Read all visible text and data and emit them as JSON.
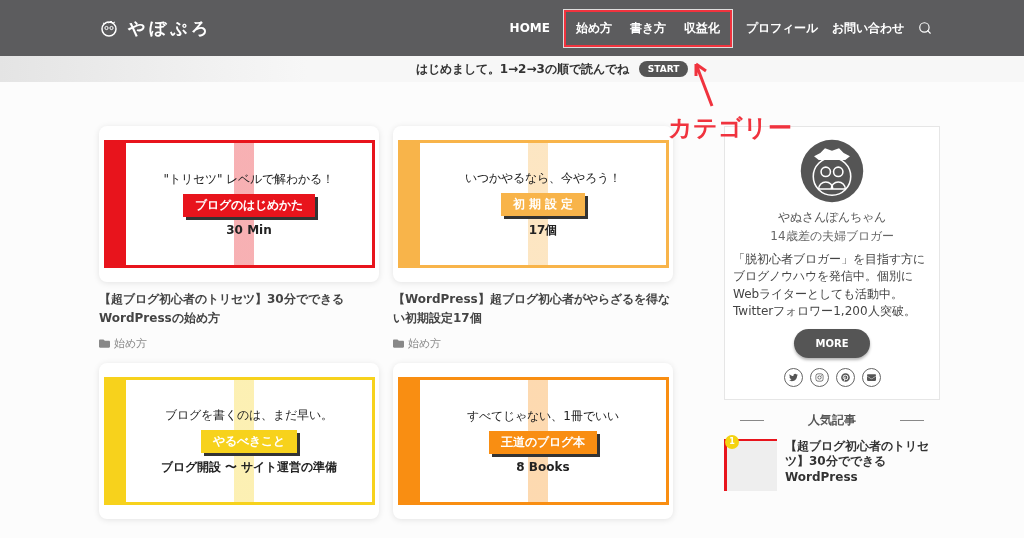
{
  "header": {
    "logo": "やぼぷろ",
    "nav": [
      {
        "label": "HOME",
        "kind": "plain"
      },
      {
        "label": "始め方",
        "kind": "category"
      },
      {
        "label": "書き方",
        "kind": "category"
      },
      {
        "label": "収益化",
        "kind": "category"
      },
      {
        "label": "プロフィール",
        "kind": "plain"
      },
      {
        "label": "お問い合わせ",
        "kind": "plain"
      }
    ]
  },
  "notice": {
    "text": "はじめまして。1→2→3の順で読んでね",
    "button": "START"
  },
  "annotation": {
    "label": "カテゴリー"
  },
  "posts": [
    {
      "title": "【超ブログ初心者のトリセツ】30分でできるWordPressの始め方",
      "category": "始め方",
      "thumb": {
        "color": "#e8141c",
        "subtitle": "\"トリセツ\" レベルで解わかる！",
        "label": "ブログのはじめかた",
        "caption": "30 Min"
      }
    },
    {
      "title": "【WordPress】超ブログ初心者がやらざるを得ない初期設定17個",
      "category": "始め方",
      "thumb": {
        "color": "#f8b44a",
        "subtitle": "いつかやるなら、今やろう！",
        "label": "初 期 設 定",
        "caption": "17個"
      }
    },
    {
      "thumb": {
        "color": "#f7d21c",
        "subtitle": "ブログを書くのは、まだ早い。",
        "label": "やるべきこと",
        "caption": "ブログ開設 〜 サイト運営の準備"
      }
    },
    {
      "thumb": {
        "color": "#f98e12",
        "subtitle": "すべてじゃない、1冊でいい",
        "label": "王道のブログ本",
        "caption": "8 Books"
      }
    }
  ],
  "profile": {
    "name": "やぬさんぽんちゃん",
    "tagline": "14歳差の夫婦ブロガー",
    "bio": "「脱初心者ブロガー」を目指す方にブログノウハウを発信中。個別にWebライターとしても活動中。Twitterフォロワー1,200人突破。",
    "button": "MORE",
    "social": [
      {
        "kind": "twitter"
      },
      {
        "kind": "instagram"
      },
      {
        "kind": "pinterest"
      },
      {
        "kind": "mail"
      }
    ]
  },
  "popular": {
    "heading": "人気記事",
    "items": [
      {
        "rank": "1",
        "title": "【超ブログ初心者のトリセツ】30分でできるWordPress",
        "color": "#e8141c"
      }
    ]
  }
}
